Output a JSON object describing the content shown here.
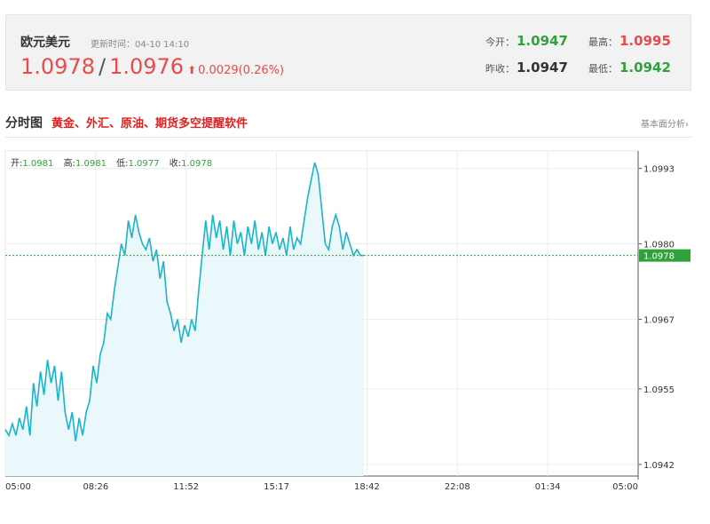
{
  "quote": {
    "name": "欧元美元",
    "time_label": "更新时间：04-10 14:10",
    "price_bid": "1.0978",
    "separator": "/",
    "price_ask": "1.0976",
    "arrow": "⬆",
    "change": "0.0029(0.26%)",
    "open_label": "今开：",
    "open_value": "1.0947",
    "prevclose_label": "昨收：",
    "prevclose_value": "1.0947",
    "high_label": "最高：",
    "high_value": "1.0995",
    "low_label": "最低：",
    "low_value": "1.0942",
    "colors": {
      "up": "#e94b4b",
      "down": "#2fa33a"
    }
  },
  "section": {
    "title": "分时图",
    "ad_text": "黄金、外汇、原油、期货多空提醒软件",
    "link_text": "基本面分析›"
  },
  "ohlc": {
    "open_label": "开:",
    "open": "1.0981",
    "high_label": "高:",
    "high": "1.0981",
    "low_label": "低:",
    "low": "1.0977",
    "close_label": "收:",
    "close": "1.0978"
  },
  "chart_data": {
    "type": "area",
    "title": "",
    "xlabel": "",
    "ylabel": "",
    "x_ticks": [
      "05:00",
      "08:26",
      "11:52",
      "15:17",
      "18:42",
      "22:08",
      "01:34",
      "05:00"
    ],
    "y_ticks": [
      1.0993,
      1.098,
      1.0967,
      1.0955,
      1.0942
    ],
    "ylim": [
      1.094,
      1.0996
    ],
    "current_price": 1.0978,
    "current_label": "1.0978",
    "line_color": "#1bb4c9",
    "fill_color": "#eaf7fb",
    "current_color": "#2fa33a",
    "grid": true,
    "series": [
      {
        "x_minutes": [
          0,
          8,
          16,
          24,
          32,
          40,
          48,
          56,
          64,
          72,
          80,
          88,
          96,
          104,
          112,
          120,
          128,
          136,
          144,
          152,
          160,
          168,
          176,
          184,
          192,
          200,
          208,
          216,
          224,
          232,
          240,
          248,
          256,
          264,
          272,
          280,
          288,
          296,
          304,
          312,
          320,
          328,
          336,
          344,
          352,
          360,
          368,
          376,
          384,
          392,
          400,
          408,
          416,
          424,
          432,
          440,
          448,
          456,
          464,
          472,
          480,
          488,
          496,
          504,
          512,
          520,
          528,
          536,
          544,
          552,
          560,
          568,
          576,
          584,
          592,
          600,
          608,
          616,
          624,
          632,
          640,
          648,
          656,
          664,
          672,
          680,
          688,
          696,
          704,
          712,
          720,
          728,
          736,
          744,
          752,
          760,
          768,
          776,
          784,
          792,
          800,
          808,
          816
        ],
        "values": [
          1.0948,
          1.0947,
          1.0949,
          1.0947,
          1.095,
          1.0948,
          1.0952,
          1.0947,
          1.0956,
          1.0952,
          1.0958,
          1.0954,
          1.096,
          1.0956,
          1.0959,
          1.0953,
          1.0958,
          1.0951,
          1.0948,
          1.0951,
          1.0946,
          1.095,
          1.0947,
          1.0951,
          1.0953,
          1.0959,
          1.0956,
          1.0961,
          1.0963,
          1.0968,
          1.0967,
          1.0972,
          1.0976,
          1.098,
          1.0978,
          1.0984,
          1.0981,
          1.0985,
          1.0982,
          1.098,
          1.0979,
          1.0981,
          1.0977,
          1.0979,
          1.0974,
          1.0977,
          1.097,
          1.0968,
          1.0965,
          1.0967,
          1.0963,
          1.0966,
          1.0964,
          1.0967,
          1.0965,
          1.0972,
          1.0978,
          1.0984,
          1.0979,
          1.0985,
          1.0981,
          1.0984,
          1.0979,
          1.0983,
          1.0978,
          1.0984,
          1.098,
          1.0982,
          1.0978,
          1.0983,
          1.098,
          1.0984,
          1.0979,
          1.0982,
          1.0978,
          1.0983,
          1.098,
          1.0982,
          1.0979,
          1.0981,
          1.0978,
          1.0983,
          1.0979,
          1.0981,
          1.098,
          1.0984,
          1.0988,
          1.0991,
          1.0994,
          1.0992,
          1.0986,
          1.098,
          1.0979,
          1.0983,
          1.0985,
          1.0983,
          1.0979,
          1.0982,
          1.098,
          1.0978,
          1.0979,
          1.0978,
          1.0978
        ]
      }
    ]
  }
}
